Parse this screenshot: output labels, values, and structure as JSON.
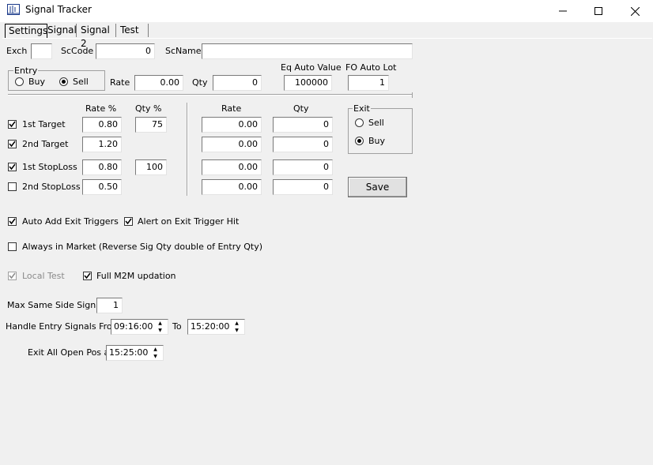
{
  "window": {
    "title": "Signal Tracker"
  },
  "tabs": [
    "Settings",
    "Signal",
    "Signal 2",
    "Test"
  ],
  "row1": {
    "exch_label": "Exch",
    "exch_value": "",
    "sccode_label": "ScCode",
    "sccode_value": "0",
    "scname_label": "ScName",
    "scname_value": ""
  },
  "entry": {
    "group_label": "Entry",
    "buy_label": "Buy",
    "sell_label": "Sell",
    "selected": "Sell",
    "rate_label": "Rate",
    "rate_value": "0.00",
    "qty_label": "Qty",
    "qty_value": "0"
  },
  "eq_auto": {
    "label": "Eq Auto Value",
    "value": "100000"
  },
  "fo_auto": {
    "label": "FO Auto Lot",
    "value": "1"
  },
  "targets": {
    "rate_header": "Rate %",
    "qty_header": "Qty %",
    "rate2_header": "Rate",
    "qty2_header": "Qty",
    "rows": [
      {
        "label": "1st Target",
        "checked": true,
        "rate_pct": "0.80",
        "qty_pct": "75",
        "rate": "0.00",
        "qty": "0"
      },
      {
        "label": "2nd Target",
        "checked": true,
        "rate_pct": "1.20",
        "qty_pct": "",
        "rate": "0.00",
        "qty": "0"
      },
      {
        "label": "1st StopLoss",
        "checked": true,
        "rate_pct": "0.80",
        "qty_pct": "100",
        "rate": "0.00",
        "qty": "0"
      },
      {
        "label": "2nd StopLoss",
        "checked": false,
        "rate_pct": "0.50",
        "qty_pct": "",
        "rate": "0.00",
        "qty": "0"
      }
    ]
  },
  "exit": {
    "group_label": "Exit",
    "sell_label": "Sell",
    "buy_label": "Buy",
    "selected": "Buy"
  },
  "save_label": "Save",
  "options": {
    "auto_add": "Auto Add Exit Triggers",
    "alert_exit": "Alert on Exit Trigger Hit",
    "always_market": "Always in Market (Reverse Sig Qty double of Entry Qty)",
    "local_test": "Local Test",
    "full_m2m": "Full M2M updation"
  },
  "max_same": {
    "label": "Max Same Side Signals",
    "value": "1"
  },
  "handle_entry": {
    "label": "Handle Entry Signals From",
    "from": "09:16:00",
    "to_label": "To",
    "to": "15:20:00"
  },
  "exit_all": {
    "label": "Exit All Open Pos at",
    "value": "15:25:00"
  },
  "icons": {
    "minimize": "minimize-icon",
    "maximize": "maximize-icon",
    "close": "close-icon"
  }
}
